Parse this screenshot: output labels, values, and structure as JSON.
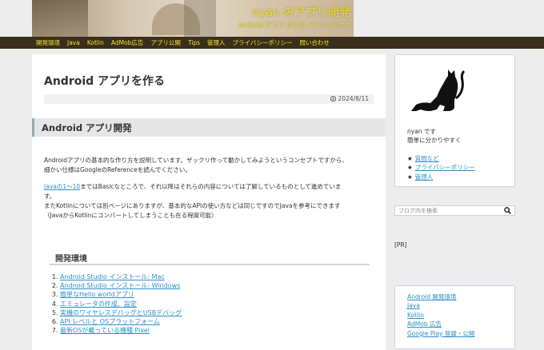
{
  "header": {
    "site_title": "nyan のアプリ開発",
    "site_subtitle": "Android アプリ 作り方 ベーシックサンプル集"
  },
  "nav": {
    "items": [
      "開発環境",
      "Java",
      "Kotlin",
      "AdMob広告",
      "アプリ公開",
      "Tips",
      "管理人",
      "プライバシーポリシー",
      "問い合わせ"
    ]
  },
  "post": {
    "title": "Android アプリを作る",
    "date": "2024/8/11",
    "section_heading": "Android アプリ開発",
    "para1_line1": "Androidアプリの基本的な作り方を説明しています。ザックリ作って動かしてみようというコンセプトですから、",
    "para1_line2": "細かい仕様はGoogleのReferenceを読んでください。",
    "para2_link": "Javaの1～10",
    "para2_line1_rest": "まではBasicなところで、それ以降はそれらの内容については了解しているものとして進めていま",
    "para2_line2": "す。",
    "para2_line3": "またKotlinについては別ページにありますが、基本的なAPIの使い方などは同じですのでJavaを参考にできます",
    "para2_line4": "（JavaからKotlinにコンバートしてしまうことも在る程度可能）",
    "subheading": "開発環境",
    "toc": [
      "Android Studio インストール: Mac",
      "Android Studio インストール: Windows",
      "簡単なHello worldアプリ",
      "エミュレータの作成、設定",
      "実機のワイヤレスデバッグとUSBデバッグ",
      "API レベルと OSプラットフォーム",
      "最新OSが載っている機種 Pixel"
    ]
  },
  "sidebar": {
    "profile_line1": "nyan です",
    "profile_line2": "簡単に分かりやすく",
    "star": "★",
    "profile_links": [
      "質問など",
      "プライバシーポリシー",
      "管理人"
    ],
    "search_placeholder": "ブログ内を検索",
    "pr_label": "[PR]",
    "categories": [
      "Android 開発環境",
      "Java",
      "Kotlin",
      "AdMob 広告",
      "Google Play 登録・公開"
    ]
  },
  "colors": {
    "nav_bg": "#3a2f1c",
    "nav_text": "#f5e12a",
    "link": "#2e8fc8"
  }
}
